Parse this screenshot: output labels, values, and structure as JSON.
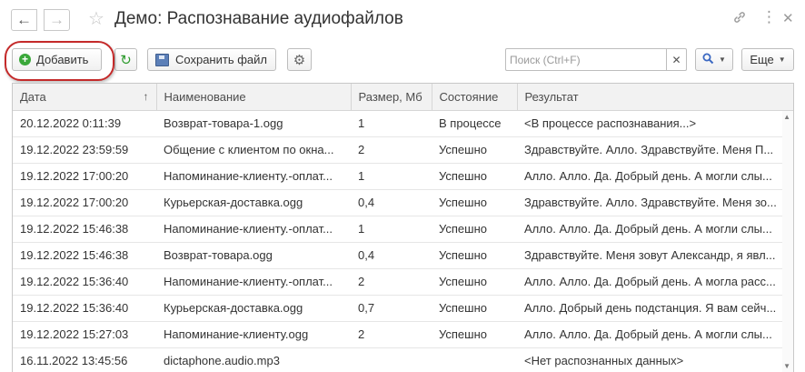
{
  "window": {
    "title": "Демо: Распознавание аудиофайлов"
  },
  "toolbar": {
    "add_label": "Добавить",
    "save_label": "Сохранить файл",
    "more_label": "Еще"
  },
  "search": {
    "placeholder": "Поиск (Ctrl+F)",
    "value": ""
  },
  "table": {
    "columns": [
      "Дата",
      "Наименование",
      "Размер, Мб",
      "Состояние",
      "Результат"
    ],
    "rows": [
      [
        "20.12.2022 0:11:39",
        "Возврат-товара-1.ogg",
        "1",
        "В процессе",
        "<В процессе распознавания...>"
      ],
      [
        "19.12.2022 23:59:59",
        "Общение с клиентом по окна...",
        "2",
        "Успешно",
        "Здравствуйте. Алло. Здравствуйте. Меня П..."
      ],
      [
        "19.12.2022 17:00:20",
        "Напоминание-клиенту.-оплат...",
        "1",
        "Успешно",
        "Алло. Алло. Да. Добрый день. А могли слы..."
      ],
      [
        "19.12.2022 17:00:20",
        "Курьерская-доставка.ogg",
        "0,4",
        "Успешно",
        "Здравствуйте. Алло. Здравствуйте. Меня зо..."
      ],
      [
        "19.12.2022 15:46:38",
        "Напоминание-клиенту.-оплат...",
        "1",
        "Успешно",
        "Алло. Алло. Да. Добрый день. А могли слы..."
      ],
      [
        "19.12.2022 15:46:38",
        "Возврат-товара.ogg",
        "0,4",
        "Успешно",
        "Здравствуйте. Меня зовут Александр, я явл..."
      ],
      [
        "19.12.2022 15:36:40",
        "Напоминание-клиенту.-оплат...",
        "2",
        "Успешно",
        "Алло. Алло. Да. Добрый день. А могла расс..."
      ],
      [
        "19.12.2022 15:36:40",
        "Курьерская-доставка.ogg",
        "0,7",
        "Успешно",
        "Алло. Добрый день подстанция. Я вам сейч..."
      ],
      [
        "19.12.2022 15:27:03",
        "Напоминание-клиенту.ogg",
        "2",
        "Успешно",
        "Алло. Алло. Да. Добрый день. А могли слы..."
      ],
      [
        "16.11.2022 13:45:56",
        "dictaphone.audio.mp3",
        "",
        "",
        "<Нет распознанных данных>"
      ]
    ]
  },
  "colors": {
    "highlight": "#c42a2a",
    "add_icon": "#3aa83a",
    "refresh_icon": "#2d9a2d",
    "search_icon": "#3b68c2"
  },
  "icons": [
    "arrow-left-icon",
    "arrow-right-icon",
    "star-icon",
    "link-icon",
    "more-vertical-icon",
    "close-icon",
    "add-icon",
    "refresh-icon",
    "save-icon",
    "gear-icon",
    "search-icon",
    "chevron-down-icon",
    "sort-up-icon"
  ]
}
